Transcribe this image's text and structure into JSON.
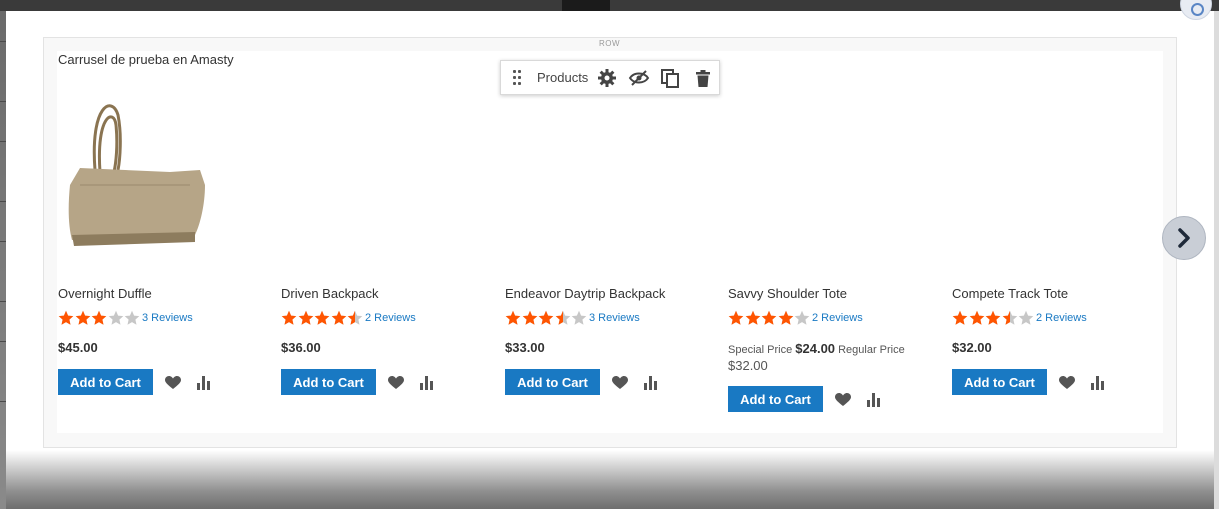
{
  "carousel": {
    "row_label": "ROW",
    "title": "Carrusel de prueba en Amasty"
  },
  "toolbar": {
    "label": "Products",
    "icons": [
      "drag-handle-icon",
      "gear-icon",
      "eye-slash-icon",
      "duplicate-icon",
      "trash-icon"
    ]
  },
  "colors": {
    "accent": "#1979c3",
    "star_filled": "#ff5501",
    "star_empty": "#c7c7c7"
  },
  "products": [
    {
      "name": "Overnight Duffle",
      "rating": 3,
      "reviews": "3  Reviews",
      "price": "$45.00",
      "button": "Add to Cart"
    },
    {
      "name": "Driven Backpack",
      "rating": 4.5,
      "reviews": "2  Reviews",
      "price": "$36.00",
      "button": "Add to Cart"
    },
    {
      "name": "Endeavor Daytrip Backpack",
      "rating": 3.5,
      "reviews": "3  Reviews",
      "price": "$33.00",
      "button": "Add to Cart"
    },
    {
      "name": "Savvy Shoulder Tote",
      "rating": 4,
      "reviews": "2  Reviews",
      "special_label": "Special Price",
      "special_price": "$24.00",
      "regular_label": "Regular Price",
      "regular_price": "$32.00",
      "button": "Add to Cart"
    },
    {
      "name": "Compete Track Tote",
      "rating": 3.5,
      "reviews": "2  Reviews",
      "price": "$32.00",
      "button": "Add to Cart"
    }
  ]
}
